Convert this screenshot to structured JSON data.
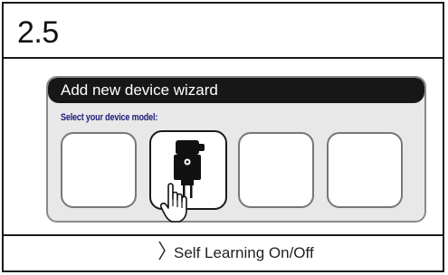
{
  "step": {
    "number": "2.5"
  },
  "wizard": {
    "title": "Add new device wizard",
    "select_label": "Select your device model:",
    "tiles": [
      {
        "icon": null
      },
      {
        "icon": "smart-plug-icon",
        "selected": true
      },
      {
        "icon": null
      },
      {
        "icon": null
      }
    ]
  },
  "cursor": {
    "icon": "hand-pointer-icon"
  },
  "footer": {
    "action_label": "Self Learning On/Off",
    "action_icon": "chevron-right-icon"
  }
}
